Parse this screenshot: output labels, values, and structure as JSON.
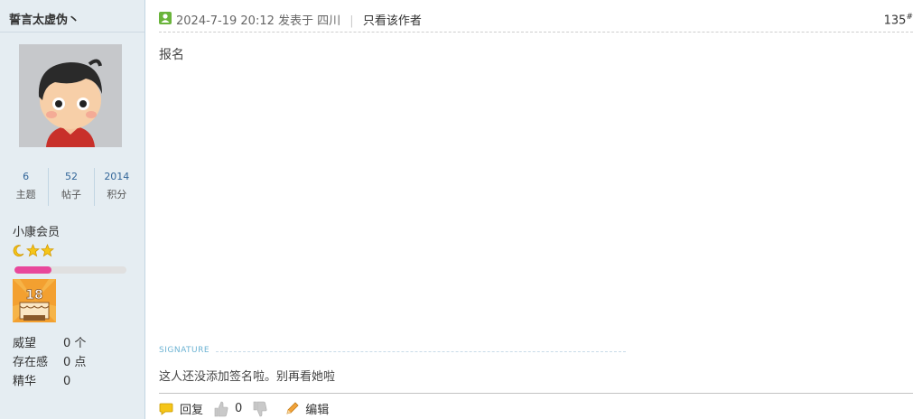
{
  "user": {
    "name": "誓言太虚伪丶",
    "stats": [
      {
        "value": "6",
        "label": "主题"
      },
      {
        "value": "52",
        "label": "帖子"
      },
      {
        "value": "2014",
        "label": "积分"
      }
    ],
    "group": "小康会员",
    "level_progress_percent": 33,
    "props": [
      {
        "label": "威望",
        "value": "0 个"
      },
      {
        "label": "存在感",
        "value": "0 点"
      },
      {
        "label": "精华",
        "value": "0"
      }
    ]
  },
  "post": {
    "date": "2024-7-19 20:12",
    "posted_in": "发表于 四川",
    "separator": "|",
    "only_author": "只看该作者",
    "floor": "135",
    "floor_mark": "#",
    "content": "报名",
    "signature_label": "SIGNATURE",
    "signature": "这人还没添加签名啦。别再看她啦"
  },
  "actions": {
    "reply": "回复",
    "like_count": "0",
    "edit": "编辑"
  },
  "colors": {
    "sidebar_bg": "#e5edf2",
    "stat_value": "#336699",
    "progress_fill": "#e8489b",
    "online": "#6ab43b"
  }
}
